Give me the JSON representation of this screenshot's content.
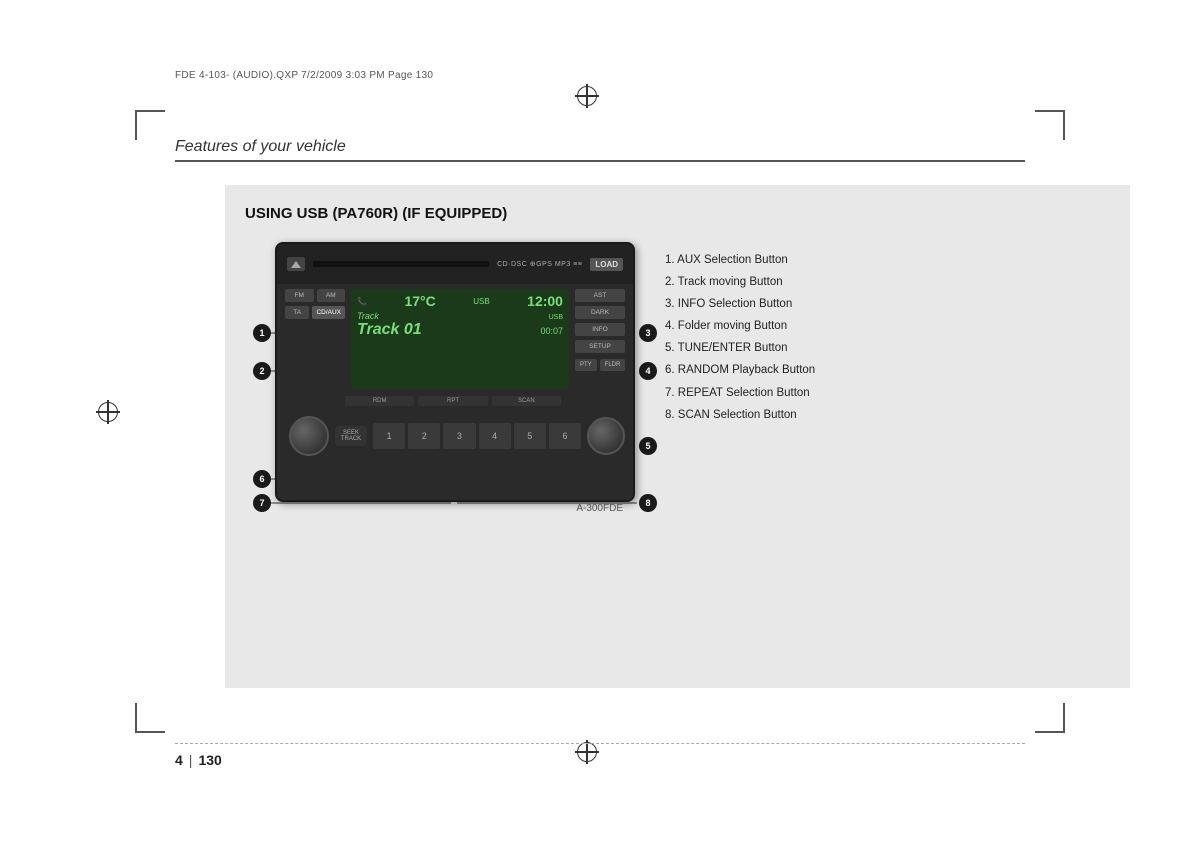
{
  "page": {
    "file_info": "FDE 4-103- (AUDIO).QXP   7/2/2009  3:03 PM  Page 130",
    "title": "Features of your vehicle",
    "section_title": "USING USB (PA760R) (IF EQUIPPED)",
    "image_ref": "A-300FDE",
    "page_number": "4",
    "page_number_secondary": "130"
  },
  "radio": {
    "load_label": "LOAD",
    "fm_label": "FM",
    "am_label": "AM",
    "ta_label": "TA",
    "cd_aux_label": "CD/AUX",
    "ast_label": "AST",
    "dark_label": "DARK",
    "info_label": "INFO",
    "setup_label": "SETUP",
    "pty_label": "PTY",
    "fldr_label": "FLDR",
    "rdm_label": "RDM",
    "rpt_label": "RPT",
    "scan_label": "SCAN",
    "seek_label": "SEEK",
    "track_label": "TRACK",
    "screen_temp": "17°C",
    "screen_mode": "USB",
    "screen_time": "12:00",
    "screen_track_label": "Track",
    "screen_track_num": "Track 01",
    "screen_time_display": "00:07",
    "screen_usb": "USB",
    "presets": [
      "1",
      "2",
      "3",
      "4",
      "5",
      "6"
    ]
  },
  "callouts": [
    {
      "number": "1",
      "text": "AUX Selection Button"
    },
    {
      "number": "2",
      "text": "Track moving Button"
    },
    {
      "number": "3",
      "text": "INFO Selection Button"
    },
    {
      "number": "4",
      "text": "Folder moving Button"
    },
    {
      "number": "5",
      "text": "TUNE/ENTER Button"
    },
    {
      "number": "6",
      "text": "RANDOM Playback Button"
    },
    {
      "number": "7",
      "text": "REPEAT Selection Button"
    },
    {
      "number": "8",
      "text": "SCAN Selection Button"
    }
  ]
}
